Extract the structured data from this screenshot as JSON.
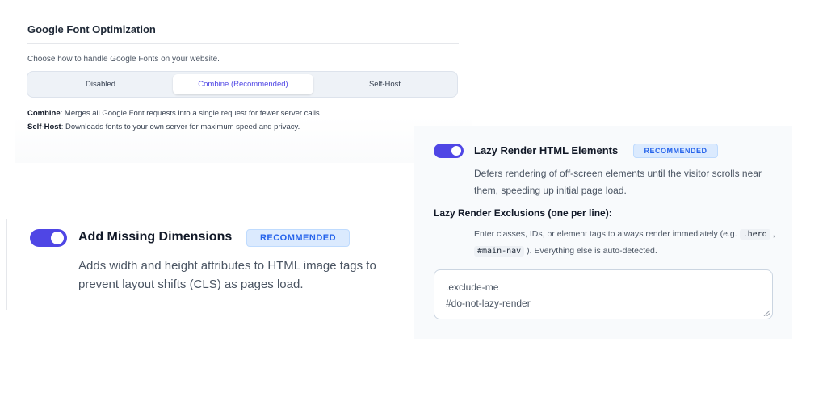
{
  "google_fonts": {
    "title": "Google Font Optimization",
    "description": "Choose how to handle Google Fonts on your website.",
    "options": [
      "Disabled",
      "Combine (Recommended)",
      "Self-Host"
    ],
    "selected": "Combine (Recommended)",
    "help": [
      {
        "term": "Combine",
        "text": ": Merges all Google Font requests into a single request for fewer server calls."
      },
      {
        "term": "Self-Host",
        "text": ": Downloads fonts to your own server for maximum speed and privacy."
      }
    ]
  },
  "lazy_render": {
    "enabled": true,
    "title": "Lazy Render HTML Elements",
    "badge": "RECOMMENDED",
    "description": "Defers rendering of off-screen elements until the visitor scrolls near them, speeding up initial page load.",
    "exclusions_title": "Lazy Render Exclusions (one per line):",
    "hint_prefix": "Enter classes, IDs, or element tags to always render immediately (e.g.",
    "hint_code_1": ".hero",
    "hint_sep": ",",
    "hint_code_2": "#main-nav",
    "hint_suffix": "). Everything else is auto-detected.",
    "exclusions_value": ".exclude-me\n#do-not-lazy-render"
  },
  "missing_dimensions": {
    "enabled": true,
    "title": "Add Missing Dimensions",
    "badge": "RECOMMENDED",
    "description": "Adds width and height attributes to HTML image tags to prevent layout shifts (CLS) as pages load."
  },
  "colors": {
    "accent": "#4f46e5",
    "badge_bg": "#dbeafe",
    "badge_text": "#2563eb"
  }
}
